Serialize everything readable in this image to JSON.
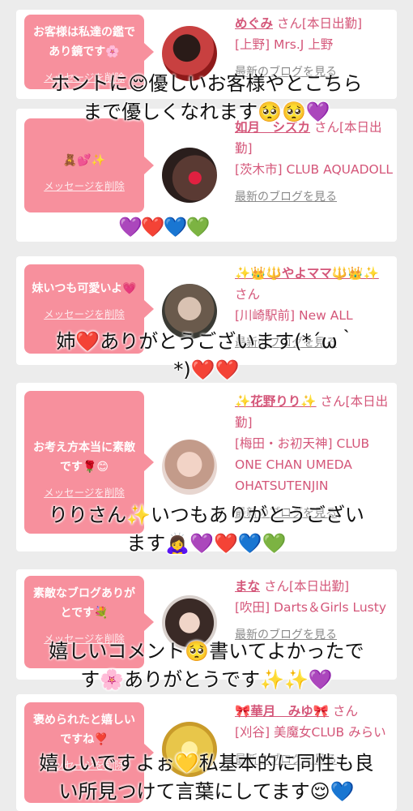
{
  "cards": [
    {
      "message": "お客様は私達の鑑であり鏡です🌸",
      "delete_label": "メッセージを削除",
      "name": "めぐみ",
      "suffix": "さん[本日出勤]",
      "shop": "[上野] Mrs.J 上野",
      "blog_label": "最新のブログを見る",
      "comment": "ホントに😌優しいお客様やとこちら\nまで優しくなれます🥺🥺💜",
      "avatar_color": "#a12424"
    },
    {
      "message": "🧸💕✨",
      "delete_label": "メッセージを削除",
      "name": "如月　シズカ",
      "suffix": "さん[本日出勤]",
      "shop": "[茨木市] CLUB AQUADOLL",
      "blog_label": "最新のブログを見る",
      "hearts": "💜❤️💙💚",
      "avatar_color": "#4a2e2a"
    },
    {
      "message": "妹いつも可愛いよ💗",
      "delete_label": "メッセージを削除",
      "name": "✨👑🔱やよママ🔱👑✨",
      "suffix": "さん",
      "shop": "[川崎駅前] New ALL",
      "blog_label": "最新のブログを見る",
      "comment": "姉❤️ありがとうございます(*´ω｀\n*)❤️❤️",
      "avatar_color": "#7a6b5c"
    },
    {
      "message": "お考え方本当に素敵です🌹😊",
      "delete_label": "メッセージを削除",
      "name": "✨花野りり✨",
      "suffix": "さん[本日出勤]",
      "shop": "[梅田・お初天神] CLUB ONE CHAN UMEDA OHATSUTENJIN",
      "blog_label": "最新のブログを見る",
      "comment": "りりさん✨いつもありがとうござい\nます🙇‍♀️💜❤️💙💚",
      "avatar_color": "#d8b8b0"
    },
    {
      "message": "素敵なブログありがとです💐",
      "delete_label": "メッセージを削除",
      "name": "まな",
      "suffix": "さん[本日出勤]",
      "shop": "[吹田] Darts＆Girls Lusty",
      "blog_label": "最新のブログを見る",
      "comment": "嬉しいコメント🥺書いてよかったで\nす🌸ありがとうです✨✨💜",
      "avatar_color": "#3a2a26"
    },
    {
      "message": "褒められたと嬉しいですね❣️",
      "delete_label": "メッセージを削除",
      "name": "🎀華月　みゆ🎀",
      "suffix": "さん",
      "shop": "[刈谷] 美魔女CLUB みらい",
      "blog_label": "最新のブログを見る",
      "comment": "嬉しいですよぉ💛私基本的に同性も良\nい所見つけて言葉にしてます😌💙",
      "avatar_color": "#e8c64a"
    }
  ]
}
